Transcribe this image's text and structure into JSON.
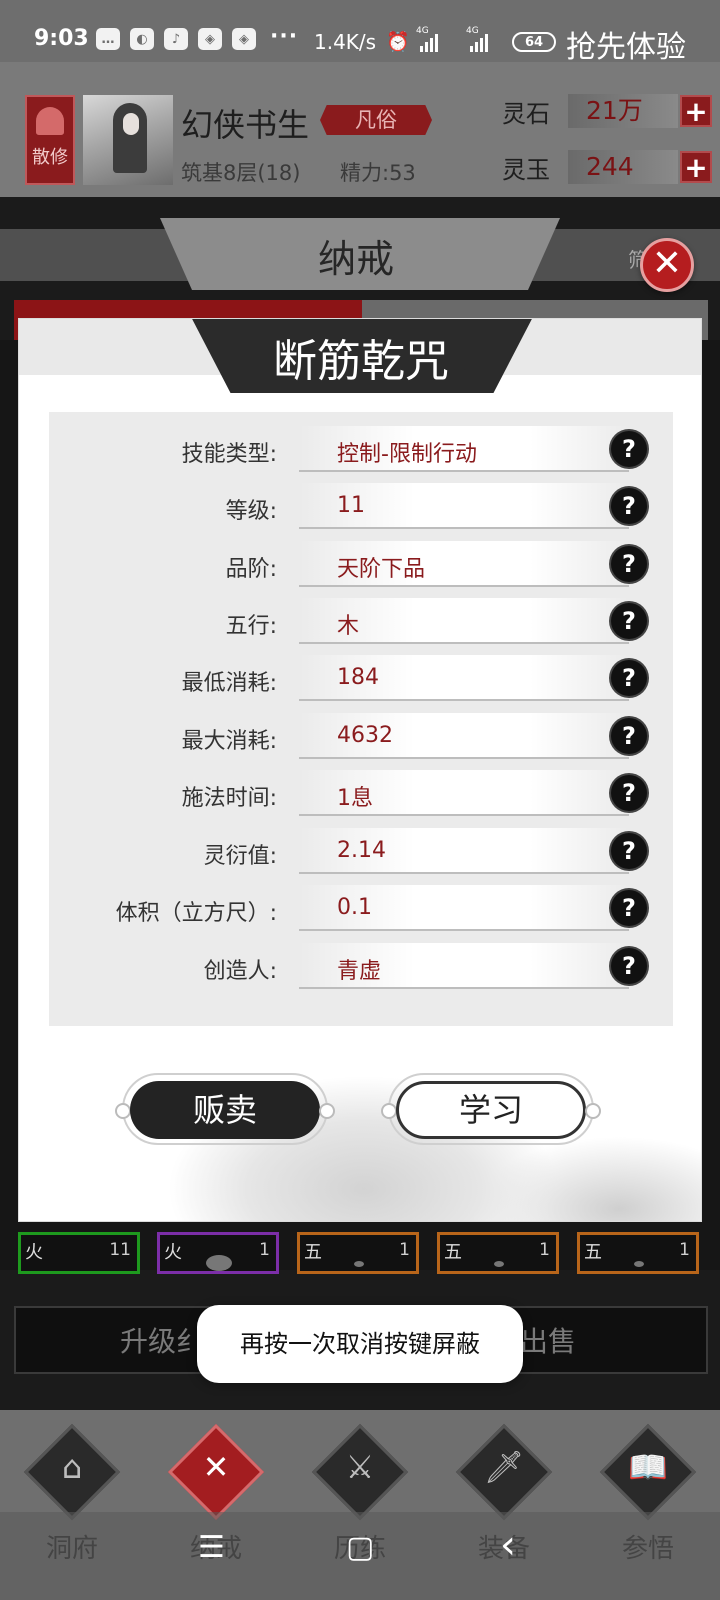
{
  "status_bar": {
    "time": "9:03",
    "app_icons": [
      "message-icon",
      "wechat-icon",
      "tiktok-icon",
      "app-icon",
      "app-icon"
    ],
    "more": "···",
    "net_speed": "1.4K/s",
    "signal1": "4G",
    "signal2": "4G",
    "battery": "64",
    "promo_text": "抢先体验"
  },
  "player": {
    "sect": "散修",
    "name": "幻侠书生",
    "rank": "凡俗",
    "level": "筑基8层(18)",
    "energy": "精力:53"
  },
  "currency": [
    {
      "label": "灵石",
      "value": "21万",
      "plus": "+"
    },
    {
      "label": "灵玉",
      "value": "244",
      "plus": "+"
    }
  ],
  "background_page": {
    "title": "纳戒",
    "filter": "筛",
    "action_left": "升级纟",
    "action_right": "键出售",
    "grid": [
      {
        "element": "火",
        "count": "11",
        "border": "#1e9a1e"
      },
      {
        "element": "火",
        "count": "1",
        "border": "#7c2ea8"
      },
      {
        "element": "五",
        "count": "1",
        "border": "#b8651a"
      },
      {
        "element": "五",
        "count": "1",
        "border": "#b8651a"
      },
      {
        "element": "五",
        "count": "1",
        "border": "#b8651a"
      }
    ]
  },
  "modal": {
    "title": "断筋乾咒",
    "close": "✕",
    "help": "?",
    "attributes": [
      {
        "label": "技能类型:",
        "value": "控制-限制行动"
      },
      {
        "label": "等级:",
        "value": "11"
      },
      {
        "label": "品阶:",
        "value": "天阶下品"
      },
      {
        "label": "五行:",
        "value": "木"
      },
      {
        "label": "最低消耗:",
        "value": "184"
      },
      {
        "label": "最大消耗:",
        "value": "4632"
      },
      {
        "label": "施法时间:",
        "value": "1息"
      },
      {
        "label": "灵衍值:",
        "value": "2.14"
      },
      {
        "label": "体积（立方尺）:",
        "value": "0.1"
      },
      {
        "label": "创造人:",
        "value": "青虚"
      }
    ],
    "sell_label": "贩卖",
    "learn_label": "学习"
  },
  "toast": "再按一次取消按键屏蔽",
  "bottom_nav": [
    {
      "label": "洞府",
      "glyph": "⌂",
      "icon": "cave-dwelling-icon",
      "active": false
    },
    {
      "label": "纳戒",
      "glyph": "✕",
      "icon": "storage-ring-icon",
      "active": true
    },
    {
      "label": "历练",
      "glyph": "⚔",
      "icon": "crossed-swords-icon",
      "active": false
    },
    {
      "label": "装备",
      "glyph": "🗡",
      "icon": "dagger-icon",
      "active": false
    },
    {
      "label": "参悟",
      "glyph": "📖",
      "icon": "open-book-icon",
      "active": false
    }
  ],
  "system_nav": {
    "menu": "☰",
    "home": "▢",
    "back": "‹"
  },
  "colors": {
    "accent_red": "#8a1b1d",
    "close_red": "#b51d1f",
    "value_red": "#8a1b1d"
  }
}
